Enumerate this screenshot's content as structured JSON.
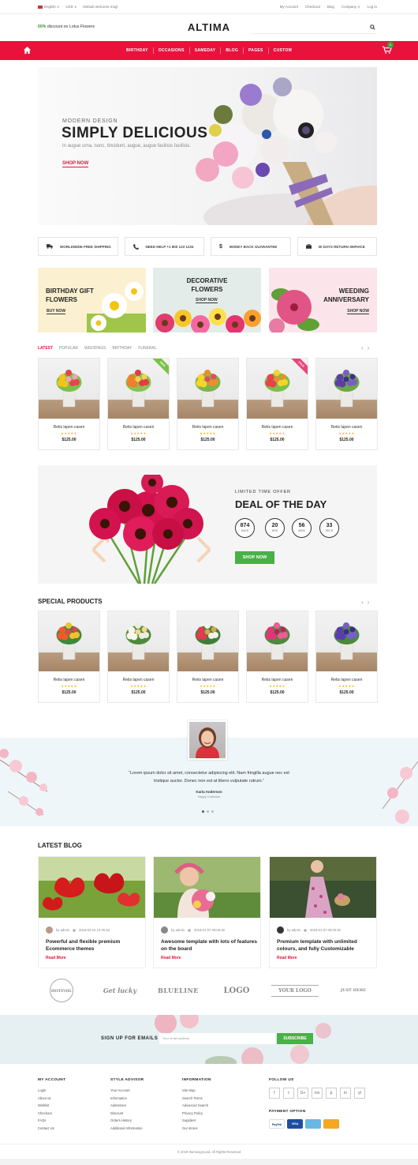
{
  "topbar": {
    "language": "English ∨",
    "currency": "USD ∨",
    "welcome": "Default welcome msg!",
    "links": [
      "My Account",
      "Checkout",
      "Blog",
      "Company ∨",
      "Log in"
    ]
  },
  "header": {
    "promo_highlight": "60%",
    "promo_text": " discount on Lotus Flowers",
    "logo": "ALTIMA"
  },
  "nav": {
    "items": [
      "BIRTHDAY",
      "OCCASIONS",
      "SAMEDAY",
      "BLOG",
      "PAGES",
      "CUSTOM"
    ],
    "cart_count": "0"
  },
  "hero": {
    "subtitle": "MODERN DESIGN",
    "title": "SIMPLY DELICIOUS",
    "description": "In augue urna, nunc, tincidunt, augue, augue facilisis facilisis.",
    "cta": "SHOP NOW"
  },
  "services": [
    {
      "icon": "truck-icon",
      "label": "WORLDWIDE FREE SHIPPING"
    },
    {
      "icon": "phone-icon",
      "label": "NEED HELP +1 800 123 1234"
    },
    {
      "icon": "dollar-icon",
      "label": "MONEY BACK GUARANTEE"
    },
    {
      "icon": "briefcase-icon",
      "label": "30 DAYS RETURN SERVICE"
    }
  ],
  "banners": [
    {
      "title_line1": "BIRTHDAY GIFT",
      "title_line2": "FLOWERS",
      "button": "BUY NOW"
    },
    {
      "title_line1": "DECORATIVE",
      "title_line2": "FLOWERS",
      "button": "SHOP NOW"
    },
    {
      "title_line1": "WEEDING",
      "title_line2": "ANNIVERSARY",
      "button": "SHOP NOW"
    }
  ],
  "tabs": [
    "LATEST",
    "POPULAR",
    "WEDDINGS",
    "BIRTHDAY",
    "FUNERAL"
  ],
  "latest_products": [
    {
      "name": "Retis lapen casen",
      "price": "$125.00",
      "stars": "★★★★★",
      "badge": ""
    },
    {
      "name": "Retis lapen casen",
      "price": "$125.00",
      "stars": "★★★★★",
      "badge": "NEW"
    },
    {
      "name": "Retis lapen casen",
      "price": "$125.00",
      "stars": "★★★★★",
      "badge": ""
    },
    {
      "name": "Retis lapen casen",
      "price": "$125.00",
      "stars": "★★★★★",
      "badge": "SALE"
    },
    {
      "name": "Retis lapen casen",
      "price": "$125.00",
      "stars": "★★★★★",
      "badge": ""
    }
  ],
  "deal": {
    "subtitle": "LIMITED TIME OFFER",
    "title": "DEAL OF THE DAY",
    "countdown": [
      {
        "value": "874",
        "unit": "DAYS"
      },
      {
        "value": "20",
        "unit": "HRS"
      },
      {
        "value": "56",
        "unit": "MINS"
      },
      {
        "value": "33",
        "unit": "SECS"
      }
    ],
    "button": "SHOP NOW"
  },
  "special": {
    "title": "SPECIAL PRODUCTS",
    "products": [
      {
        "name": "Retis lapen casen",
        "price": "$125.00",
        "stars": "★★★★★"
      },
      {
        "name": "Retis lapen casen",
        "price": "$125.00",
        "stars": "★★★★★"
      },
      {
        "name": "Retis lapen casen",
        "price": "$125.00",
        "stars": "★★★★★"
      },
      {
        "name": "Retis lapen casen",
        "price": "$125.00",
        "stars": "★★★★★"
      },
      {
        "name": "Retis lapen casen",
        "price": "$125.00",
        "stars": "★★★★★"
      }
    ]
  },
  "testimonial": {
    "quote_line1": "“Lorem ipsum dolor sit amet, consectetur adipiscing elit. Nam fringilla augue nec est",
    "quote_line2": "tristique auctor. Donec non est at libero vulputate rutrum.”",
    "name": "Karla Anderson",
    "role": "Happy Customer"
  },
  "blog": {
    "title": "LATEST BLOG",
    "posts": [
      {
        "author": "by admin",
        "date": "2018-02-24 12:25:18",
        "title": "Powerful and flexible premium Ecommerce themes",
        "more": "Read More"
      },
      {
        "author": "by admin",
        "date": "2018-01-07 08:05:49",
        "title": "Awesome template with lots of features on the board",
        "more": "Read More"
      },
      {
        "author": "by admin",
        "date": "2018-01-07 08:05:49",
        "title": "Premium template with unlimited colours, and fully Customizable",
        "more": "Read More"
      }
    ]
  },
  "brands": [
    "HOTFOIL",
    "Get lucky",
    "BLUELINE",
    "LOGO",
    "YOUR LOGO",
    "JUST HERE"
  ],
  "newsletter": {
    "label": "SIGN UP FOR EMAILS",
    "placeholder": "Your email address",
    "button": "SUBSCRIBE"
  },
  "footer": {
    "my_account": {
      "title": "MY ACCOUNT",
      "links": [
        "Login",
        "About us",
        "Wishlist",
        "Checkout",
        "FAQs",
        "Contact Us"
      ]
    },
    "style_advisor": {
      "title": "STYLE ADVISOR",
      "links": [
        "Your Account",
        "Information",
        "Addresses",
        "Discount",
        "Orders History",
        "Additional Information"
      ]
    },
    "information": {
      "title": "INFORMATION",
      "links": [
        "Site Map",
        "Search Terms",
        "Advanced Search",
        "Privacy Policy",
        "Suppliers",
        "Our stores"
      ]
    },
    "follow_us": {
      "title": "FOLLOW US",
      "icons": [
        "f",
        "t",
        "G+",
        "rss",
        "p",
        "in",
        "yt"
      ]
    },
    "payment": {
      "title": "PAYMENT OPTION",
      "methods": [
        "PayPal",
        "VISA",
        "",
        ""
      ]
    },
    "copyright": "© 2019 themesground. All Rights Reserved"
  },
  "colors": {
    "accent": "#e8123b",
    "green": "#48b148"
  }
}
